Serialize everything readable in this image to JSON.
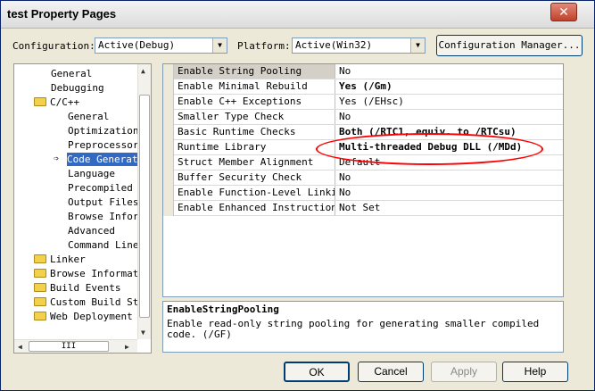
{
  "window": {
    "title": "test Property Pages",
    "close_glyph": "✕"
  },
  "top_bar": {
    "configuration_label": "Configuration:",
    "configuration_value": "Active(Debug)",
    "platform_label": "Platform:",
    "platform_value": "Active(Win32)",
    "config_manager_label": "Configuration Manager..."
  },
  "tree": {
    "items": [
      {
        "label": "General"
      },
      {
        "label": "Debugging"
      },
      {
        "label": "C/C++"
      },
      {
        "label": "General"
      },
      {
        "label": "Optimization"
      },
      {
        "label": "Preprocessor"
      },
      {
        "label": "Code Generation"
      },
      {
        "label": "Language"
      },
      {
        "label": "Precompiled Headers"
      },
      {
        "label": "Output Files"
      },
      {
        "label": "Browse Information"
      },
      {
        "label": "Advanced"
      },
      {
        "label": "Command Line"
      },
      {
        "label": "Linker"
      },
      {
        "label": "Browse Information"
      },
      {
        "label": "Build Events"
      },
      {
        "label": "Custom Build Step"
      },
      {
        "label": "Web Deployment"
      }
    ],
    "hscroll_thumb": "III"
  },
  "grid": {
    "rows": [
      {
        "name": "Enable String Pooling",
        "value": "No"
      },
      {
        "name": "Enable Minimal Rebuild",
        "value": "Yes (/Gm)"
      },
      {
        "name": "Enable C++ Exceptions",
        "value": "Yes (/EHsc)"
      },
      {
        "name": "Smaller Type Check",
        "value": "No"
      },
      {
        "name": "Basic Runtime Checks",
        "value": "Both (/RTC1, equiv. to /RTCsu)"
      },
      {
        "name": "Runtime Library",
        "value": "Multi-threaded Debug DLL (/MDd)"
      },
      {
        "name": "Struct Member Alignment",
        "value": "Default"
      },
      {
        "name": "Buffer Security Check",
        "value": "No"
      },
      {
        "name": "Enable Function-Level Linking",
        "value": "No"
      },
      {
        "name": "Enable Enhanced Instruction Set",
        "value": "Not Set"
      }
    ]
  },
  "description": {
    "title": "EnableStringPooling",
    "text": "Enable read-only string pooling for generating smaller compiled code. (/GF)"
  },
  "buttons": {
    "ok": "OK",
    "cancel": "Cancel",
    "apply": "Apply",
    "help": "Help"
  },
  "colors": {
    "selection": "#316ac5",
    "annotation": "#ff0000",
    "dialog_bg": "#ece9d8"
  }
}
